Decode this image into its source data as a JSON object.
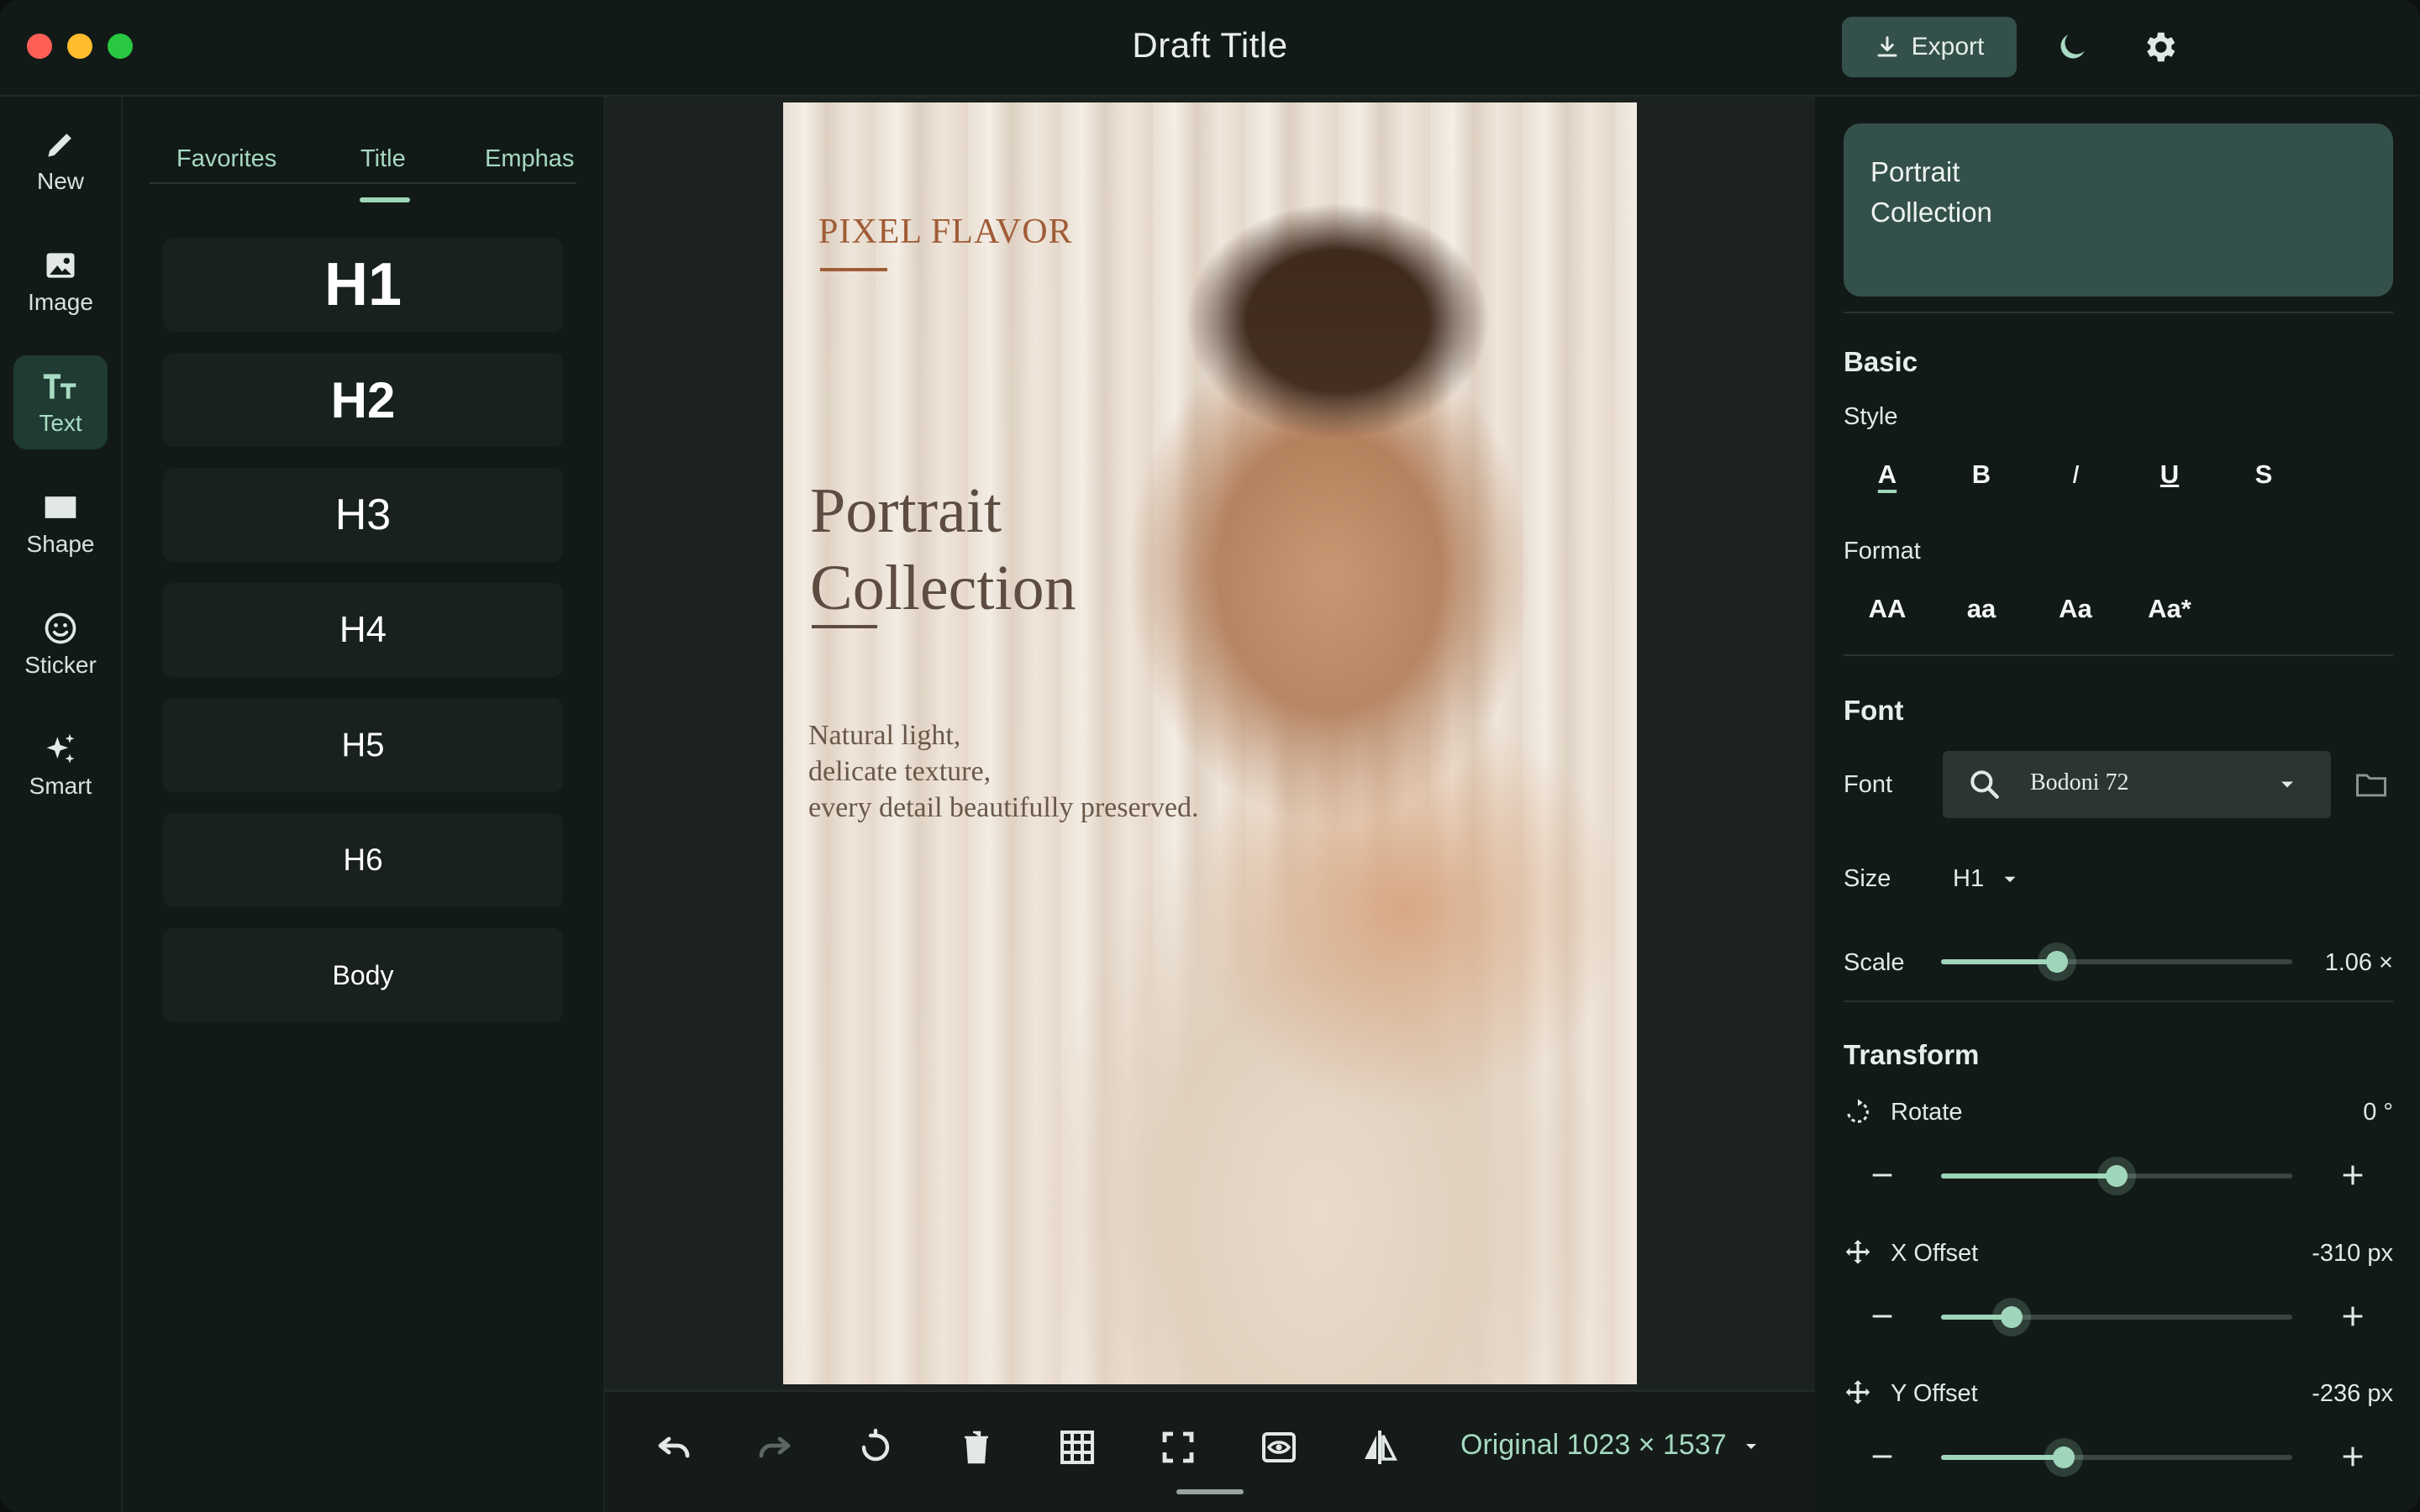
{
  "window": {
    "title": "Draft Title"
  },
  "header": {
    "export_label": "Export"
  },
  "rail": {
    "items": [
      {
        "label": "New"
      },
      {
        "label": "Image"
      },
      {
        "label": "Text"
      },
      {
        "label": "Shape"
      },
      {
        "label": "Sticker"
      },
      {
        "label": "Smart"
      }
    ]
  },
  "panel": {
    "tabs": [
      {
        "label": "Favorites"
      },
      {
        "label": "Title"
      },
      {
        "label": "Emphas"
      }
    ],
    "styles": [
      {
        "label": "H1"
      },
      {
        "label": "H2"
      },
      {
        "label": "H3"
      },
      {
        "label": "H4"
      },
      {
        "label": "H5"
      },
      {
        "label": "H6"
      },
      {
        "label": "Body"
      }
    ]
  },
  "poster": {
    "brand": "PIXEL FLAVOR",
    "headline_1": "Portrait",
    "headline_2": "Collection",
    "sub_1": "Natural light,",
    "sub_2": "delicate texture,",
    "sub_3": "every detail beautifully preserved."
  },
  "toolbar": {
    "size_label": "Original 1023 × 1537"
  },
  "inspector": {
    "text_value": "Portrait\nCollection",
    "basic_title": "Basic",
    "style_label": "Style",
    "style_options": [
      "A",
      "B",
      "I",
      "U",
      "S"
    ],
    "format_label": "Format",
    "format_options": [
      "AA",
      "aa",
      "Aa",
      "Aa*"
    ],
    "font_title": "Font",
    "font_label": "Font",
    "font_value": "Bodoni 72",
    "size_label": "Size",
    "size_value": "H1",
    "scale_label": "Scale",
    "scale_value": "1.06 ×",
    "scale_fraction": 0.33,
    "transform_title": "Transform",
    "rotate_label": "Rotate",
    "rotate_value": "0 °",
    "rotate_fraction": 0.5,
    "x_offset_label": "X Offset",
    "x_offset_value": "-310 px",
    "x_offset_fraction": 0.2,
    "y_offset_label": "Y Offset",
    "y_offset_value": "-236 px",
    "y_offset_fraction": 0.35
  },
  "colors": {
    "accent": "#9fd6bb",
    "active_bg": "#1f3b33",
    "button_bg": "#34504a"
  }
}
